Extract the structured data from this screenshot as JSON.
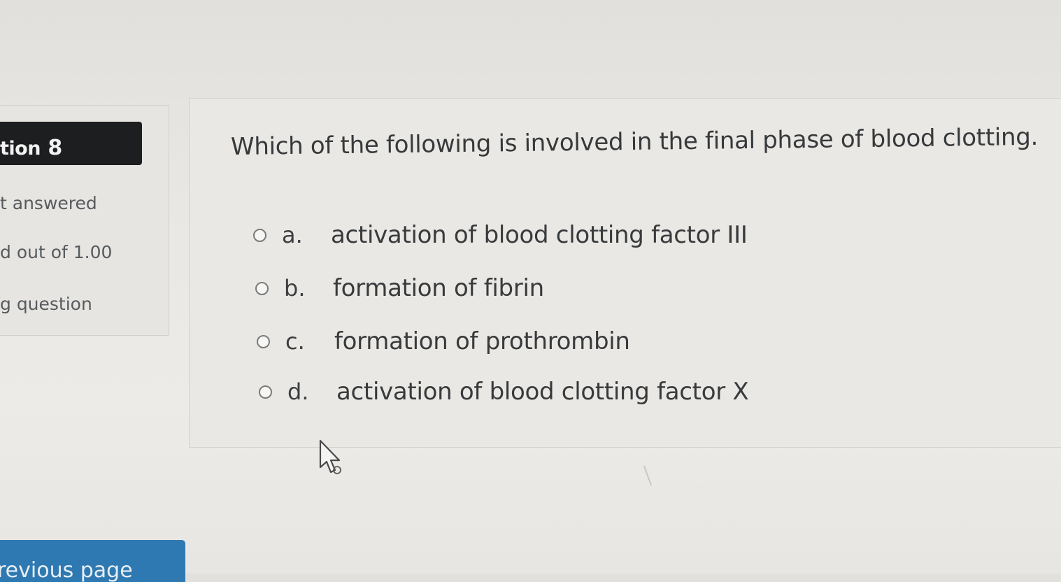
{
  "info": {
    "question_word": "tion",
    "question_number": "8",
    "status": "t answered",
    "mark": "d out of 1.00",
    "flag": "g question"
  },
  "question": {
    "text": "Which of the following is involved in the final phase of blood clotting."
  },
  "options": [
    {
      "letter": "a.",
      "text": "activation of blood clotting factor III"
    },
    {
      "letter": "b.",
      "text": "formation of fibrin"
    },
    {
      "letter": "c.",
      "text": "formation of prothrombin"
    },
    {
      "letter": "d.",
      "text": "activation of blood clotting factor X"
    }
  ],
  "navigation": {
    "previous_label": "revious page"
  },
  "colors": {
    "question_box": "#1d1e20",
    "prev_button": "#2f79b2",
    "background": "#e9e7e3"
  },
  "icons": {
    "cursor": "mouse-pointer-icon",
    "radio": "radio-unchecked-icon"
  }
}
